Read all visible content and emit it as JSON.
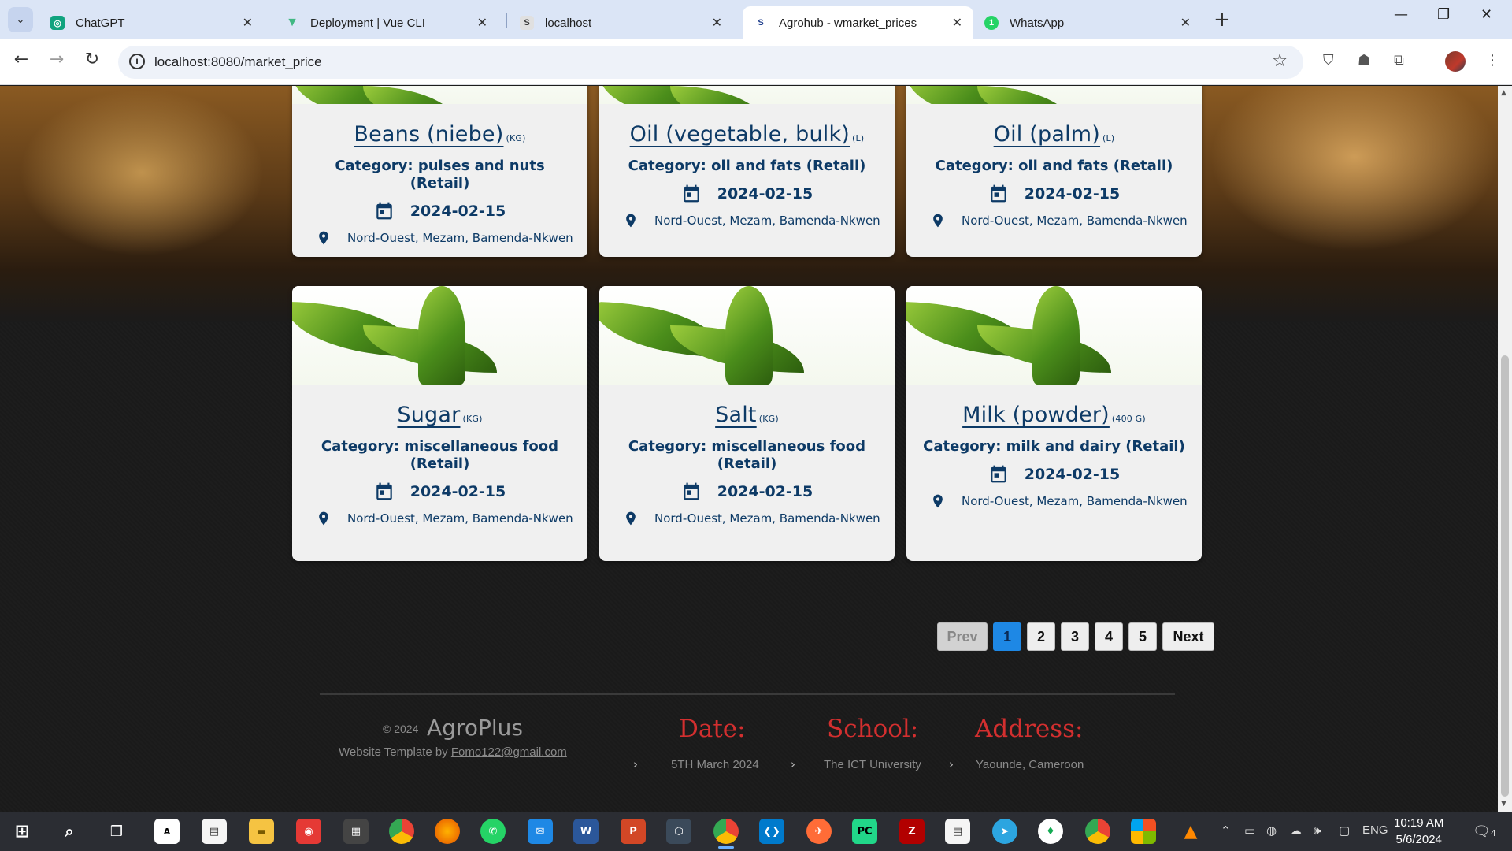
{
  "browser": {
    "tabs": [
      {
        "title": "ChatGPT",
        "favicon": "chatgpt-icon",
        "active": false
      },
      {
        "title": "Deployment | Vue CLI",
        "favicon": "vue-icon",
        "active": false
      },
      {
        "title": "localhost",
        "favicon": "s-icon",
        "active": false
      },
      {
        "title": "Agrohub - wmarket_prices",
        "favicon": "s-icon",
        "active": true
      },
      {
        "title": "WhatsApp",
        "favicon": "whatsapp-icon",
        "active": false
      }
    ],
    "url": "localhost:8080/market_price"
  },
  "products": [
    {
      "name": "Beans (niebe)",
      "unit": "(KG)",
      "category": "Category: pulses and nuts (Retail)",
      "date": "2024-02-15",
      "location": "Nord-Ouest, Mezam, Bamenda-Nkwen"
    },
    {
      "name": "Oil (vegetable, bulk)",
      "unit": "(L)",
      "category": "Category: oil and fats (Retail)",
      "date": "2024-02-15",
      "location": "Nord-Ouest, Mezam, Bamenda-Nkwen"
    },
    {
      "name": "Oil (palm)",
      "unit": "(L)",
      "category": "Category: oil and fats (Retail)",
      "date": "2024-02-15",
      "location": "Nord-Ouest, Mezam, Bamenda-Nkwen"
    },
    {
      "name": "Sugar",
      "unit": "(KG)",
      "category": "Category: miscellaneous food (Retail)",
      "date": "2024-02-15",
      "location": "Nord-Ouest, Mezam, Bamenda-Nkwen"
    },
    {
      "name": "Salt",
      "unit": "(KG)",
      "category": "Category: miscellaneous food (Retail)",
      "date": "2024-02-15",
      "location": "Nord-Ouest, Mezam, Bamenda-Nkwen"
    },
    {
      "name": "Milk (powder)",
      "unit": "(400 G)",
      "category": "Category: milk and dairy (Retail)",
      "date": "2024-02-15",
      "location": "Nord-Ouest, Mezam, Bamenda-Nkwen"
    }
  ],
  "pagination": {
    "prev": "Prev",
    "pages": [
      "1",
      "2",
      "3",
      "4",
      "5"
    ],
    "current": "1",
    "next": "Next"
  },
  "footer": {
    "copyright": "© 2024",
    "brand": "AgroPlus",
    "template_prefix": "Website Template by",
    "email": "Fomo122@gmail.com",
    "date_label": "Date:",
    "date_value": "5TH March 2024",
    "school_label": "School:",
    "school_value": "The ICT University",
    "address_label": "Address:",
    "address_value": "Yaounde, Cameroon"
  },
  "taskbar": {
    "time": "10:19 AM",
    "date": "5/6/2024",
    "lang": "ENG",
    "notifications": "4"
  },
  "colors": {
    "card_text": "#0d3a66",
    "footer_heading": "#d32f2f",
    "page_active": "#1e88e5"
  }
}
